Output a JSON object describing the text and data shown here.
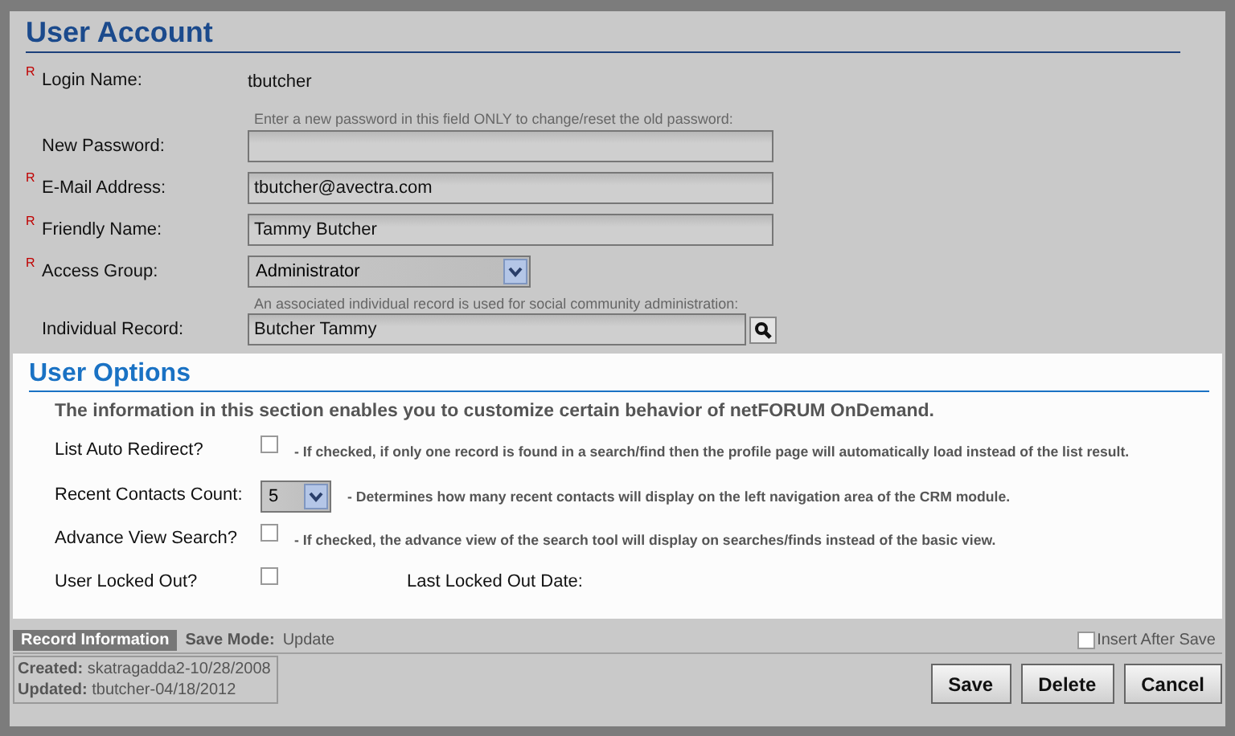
{
  "account": {
    "title": "User Account",
    "fields": [
      {
        "kind": "static",
        "mark": "R",
        "label": "Login Name:",
        "value": "tbutcher"
      },
      {
        "kind": "text",
        "label": "New Password:",
        "hint": "Enter a new password in this field ONLY to change/reset the old password:"
      },
      {
        "kind": "text",
        "mark": "R",
        "label": "E-Mail Address:",
        "value": "tbutcher@avectra.com"
      },
      {
        "kind": "text",
        "mark": "R",
        "label": "Friendly Name:",
        "value": "Tammy Butcher"
      },
      {
        "kind": "select",
        "mark": "R",
        "label": "Access Group:",
        "value": "Administrator"
      },
      {
        "kind": "lookup",
        "label": "Individual Record:",
        "hint": "An associated individual record is used for social community administration:",
        "value": "Butcher Tammy"
      }
    ]
  },
  "options": {
    "title": "User Options",
    "description": "The information in this section enables you to customize certain behavior of netFORUM OnDemand.",
    "rows": [
      {
        "kind": "checkbox",
        "label": "List Auto Redirect?",
        "checked": false,
        "note": "- If checked, if only one record is found in a search/find then the profile page will automatically load instead of the list result."
      },
      {
        "kind": "select",
        "label": "Recent Contacts Count:",
        "value": "5",
        "note": "- Determines how many recent contacts will display on the left navigation area of the CRM module."
      },
      {
        "kind": "checkbox",
        "label": "Advance View Search?",
        "checked": false,
        "note": "- If checked, the advance view of the search tool will display on searches/finds instead of the basic view."
      },
      {
        "kind": "checkbox",
        "label": "User Locked Out?",
        "checked": false,
        "side_label": "Last Locked Out Date:"
      }
    ]
  },
  "footer": {
    "record_info": "Record Information",
    "save_mode_label": "Save Mode:",
    "save_mode": "Update",
    "insert_after_save": {
      "label": "Insert After Save",
      "checked": false
    },
    "audit": [
      {
        "label": "Created:",
        "value": "skatragadda2-10/28/2008"
      },
      {
        "label": "Updated:",
        "value": "tbutcher-04/18/2012"
      }
    ],
    "buttons": [
      "Save",
      "Delete",
      "Cancel"
    ]
  }
}
